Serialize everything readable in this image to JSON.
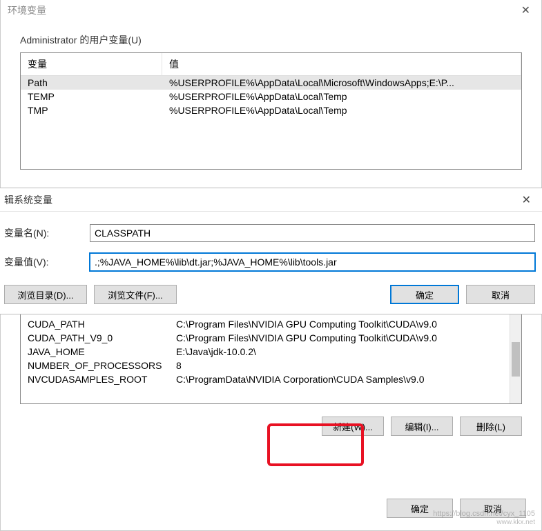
{
  "dialog": {
    "title": "环境变量",
    "close": "✕"
  },
  "user_section": {
    "label": "Administrator 的用户变量(U)",
    "headers": {
      "var": "变量",
      "val": "值"
    },
    "rows": [
      {
        "var": "Path",
        "val": "%USERPROFILE%\\AppData\\Local\\Microsoft\\WindowsApps;E:\\P..."
      },
      {
        "var": "TEMP",
        "val": "%USERPROFILE%\\AppData\\Local\\Temp"
      },
      {
        "var": "TMP",
        "val": "%USERPROFILE%\\AppData\\Local\\Temp"
      }
    ]
  },
  "edit_dialog": {
    "title_prefix": "辑系统变量",
    "close": "✕",
    "name_label": "变量名(N):",
    "value_label": "变量值(V):",
    "name_value": "CLASSPATH",
    "value_value": ".;%JAVA_HOME%\\lib\\dt.jar;%JAVA_HOME%\\lib\\tools.jar",
    "browse_dir": "浏览目录(D)...",
    "browse_file": "浏览文件(F)...",
    "ok": "确定",
    "cancel": "取消"
  },
  "sys_section": {
    "rows": [
      {
        "var": "CUDA_PATH",
        "val": "C:\\Program Files\\NVIDIA GPU Computing Toolkit\\CUDA\\v9.0"
      },
      {
        "var": "CUDA_PATH_V9_0",
        "val": "C:\\Program Files\\NVIDIA GPU Computing Toolkit\\CUDA\\v9.0"
      },
      {
        "var": "JAVA_HOME",
        "val": "E:\\Java\\jdk-10.0.2\\"
      },
      {
        "var": "NUMBER_OF_PROCESSORS",
        "val": "8"
      },
      {
        "var": "NVCUDASAMPLES_ROOT",
        "val": "C:\\ProgramData\\NVIDIA Corporation\\CUDA Samples\\v9.0"
      }
    ],
    "buttons": {
      "new": "新建(W)...",
      "edit": "编辑(I)...",
      "delete": "删除(L)"
    }
  },
  "bottom": {
    "ok": "确定",
    "cancel": "取消"
  },
  "watermark": {
    "line1": "https://blog.csdn.net/cyx_1105",
    "line2": "www.kkx.net"
  }
}
